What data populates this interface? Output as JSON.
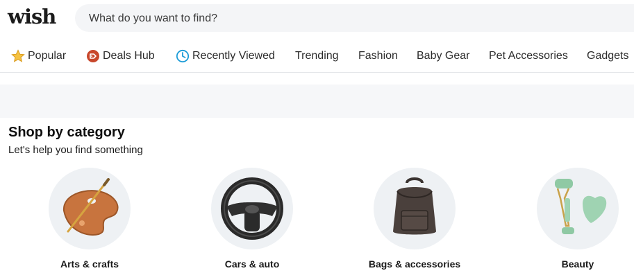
{
  "header": {
    "logo_text": "wish",
    "search_placeholder": "What do you want to find?"
  },
  "nav": {
    "items": [
      {
        "label": "Popular",
        "icon": "star-icon"
      },
      {
        "label": "Deals Hub",
        "icon": "deals-tag-icon"
      },
      {
        "label": "Recently Viewed",
        "icon": "clock-icon"
      },
      {
        "label": "Trending"
      },
      {
        "label": "Fashion"
      },
      {
        "label": "Baby Gear"
      },
      {
        "label": "Pet Accessories"
      },
      {
        "label": "Gadgets"
      }
    ]
  },
  "section": {
    "title": "Shop by category",
    "subtitle": "Let's help you find something"
  },
  "categories": [
    {
      "label": "Arts & crafts",
      "image": "paint-palette-image"
    },
    {
      "label": "Cars & auto",
      "image": "steering-wheel-image"
    },
    {
      "label": "Bags & accessories",
      "image": "backpack-image"
    },
    {
      "label": "Beauty",
      "image": "jade-roller-image"
    }
  ],
  "colors": {
    "search_bg": "#f4f5f7",
    "category_circle_bg": "#eef1f4",
    "star_icon": "#f5c242",
    "deals_icon": "#c8472b",
    "clock_icon": "#1a9bd7"
  }
}
